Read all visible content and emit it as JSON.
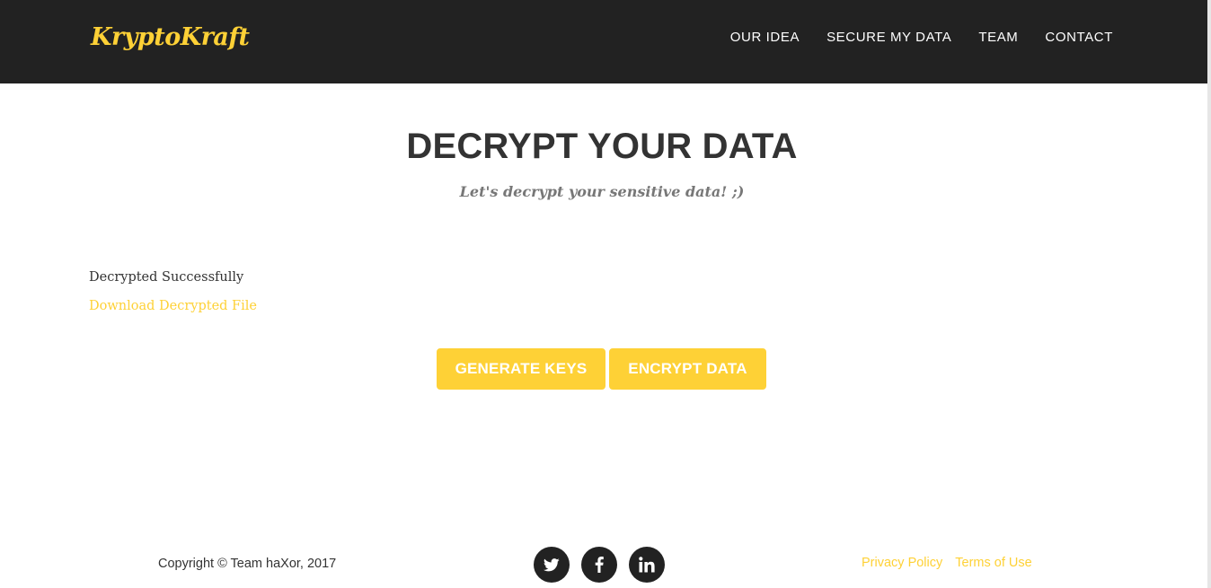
{
  "navbar": {
    "brand": "KryptoKraft",
    "items": [
      {
        "label": "OUR IDEA"
      },
      {
        "label": "SECURE MY DATA"
      },
      {
        "label": "TEAM"
      },
      {
        "label": "CONTACT"
      }
    ]
  },
  "header": {
    "title": "DECRYPT YOUR DATA",
    "subtitle": "Let's decrypt your sensitive data! ;)"
  },
  "result": {
    "status": "Decrypted Successfully",
    "download_label": "Download Decrypted File"
  },
  "actions": {
    "generate_label": "GENERATE KEYS",
    "encrypt_label": "ENCRYPT DATA"
  },
  "footer": {
    "copyright": "Copyright © Team haXor, 2017",
    "social": [
      {
        "icon": "twitter-icon"
      },
      {
        "icon": "facebook-icon"
      },
      {
        "icon": "linkedin-icon"
      }
    ],
    "links": [
      {
        "label": "Privacy Policy"
      },
      {
        "label": "Terms of Use"
      }
    ]
  },
  "colors": {
    "accent": "#fed136",
    "dark": "#222222",
    "text": "#333333",
    "muted": "#777777"
  }
}
